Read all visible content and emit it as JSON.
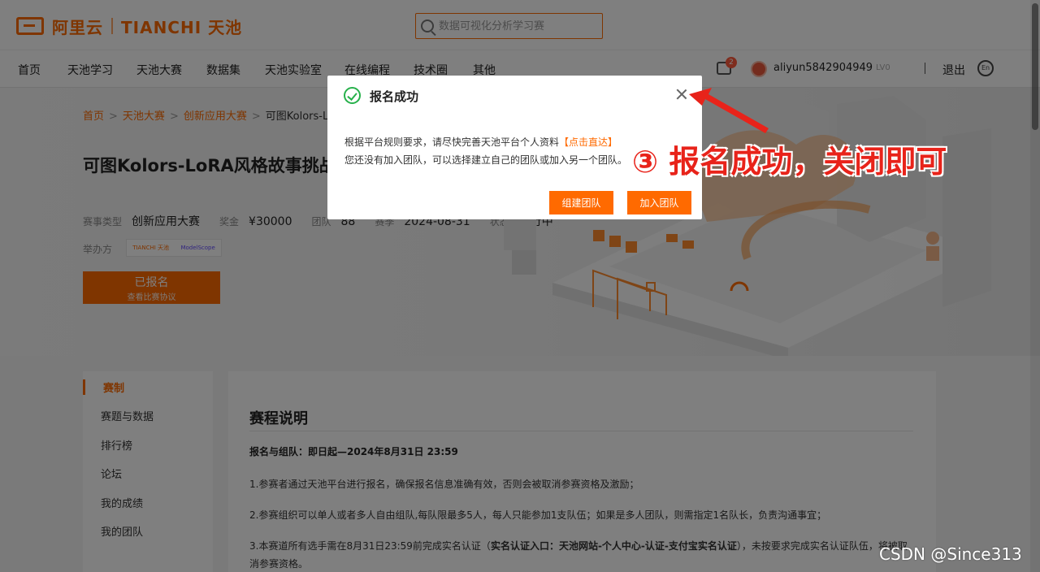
{
  "header": {
    "logo_cn": "阿里云",
    "logo_en": "TIANCHI 天池",
    "search_placeholder": "数据可视化分析学习赛"
  },
  "nav": {
    "items": [
      "首页",
      "天池学习",
      "天池大赛",
      "数据集",
      "天池实验室",
      "在线编程",
      "技术圈",
      "其他"
    ]
  },
  "user": {
    "message_count": "2",
    "username": "aliyun5842904949",
    "level": "LV0",
    "logout": "退出",
    "lang": "En"
  },
  "breadcrumb": [
    "首页",
    "天池大赛",
    "创新应用大赛",
    "可图Kolors-LoRA风格故事挑战赛"
  ],
  "competition": {
    "title": "可图Kolors-LoRA风格故事挑战赛",
    "type_label": "赛事类型",
    "type_value": "创新应用大赛",
    "prize_label": "奖金",
    "prize_value": "¥30000",
    "teams_label": "团队",
    "teams_value": "88",
    "deadline_label": "赛季",
    "deadline_value": "2024-08-31",
    "status_label": "状态",
    "status_value": "进行中",
    "organizer_label": "举办方",
    "org_logo_1": "TIANCHI 天池",
    "org_logo_2": "ModelScope",
    "signed_label": "已报名",
    "signed_sub": "查看比赛协议"
  },
  "sidebar": {
    "items": [
      "赛制",
      "赛题与数据",
      "排行榜",
      "论坛",
      "我的成绩",
      "我的团队"
    ]
  },
  "main": {
    "title": "赛程说明",
    "subtitle": "报名与组队：即日起—2024年8月31日 23:59",
    "rule1": "1.参赛者通过天池平台进行报名，确保报名信息准确有效，否则会被取消参赛资格及激励；",
    "rule2": "2.参赛组织可以单人或者多人自由组队,每队限最多5人，每人只能参加1支队伍；如果是多人团队，则需指定1名队长，负责沟通事宜；",
    "rule3_a": "3.本赛道所有选手需在8月31日23:59前完成实名认证（",
    "rule3_b": "实名认证入口：天池网站-个人中心-认证-支付宝实名认证",
    "rule3_c": "），未按要求完成实名认证队伍，将被取消参赛资格。"
  },
  "modal": {
    "title": "报名成功",
    "line1_text": "根据平台规则要求，请尽快完善天池平台个人资料",
    "line1_link": "【点击直达】",
    "line2": "您还没有加入团队，可以选择建立自己的团队或加入另一个团队。",
    "btn_create": "组建团队",
    "btn_join": "加入团队"
  },
  "annotation": {
    "text": "③ 报名成功，关闭即可",
    "color": "#e8231a"
  },
  "watermark": "CSDN @Since313",
  "colors": {
    "accent": "#ff6a00",
    "success": "#27b14b"
  }
}
